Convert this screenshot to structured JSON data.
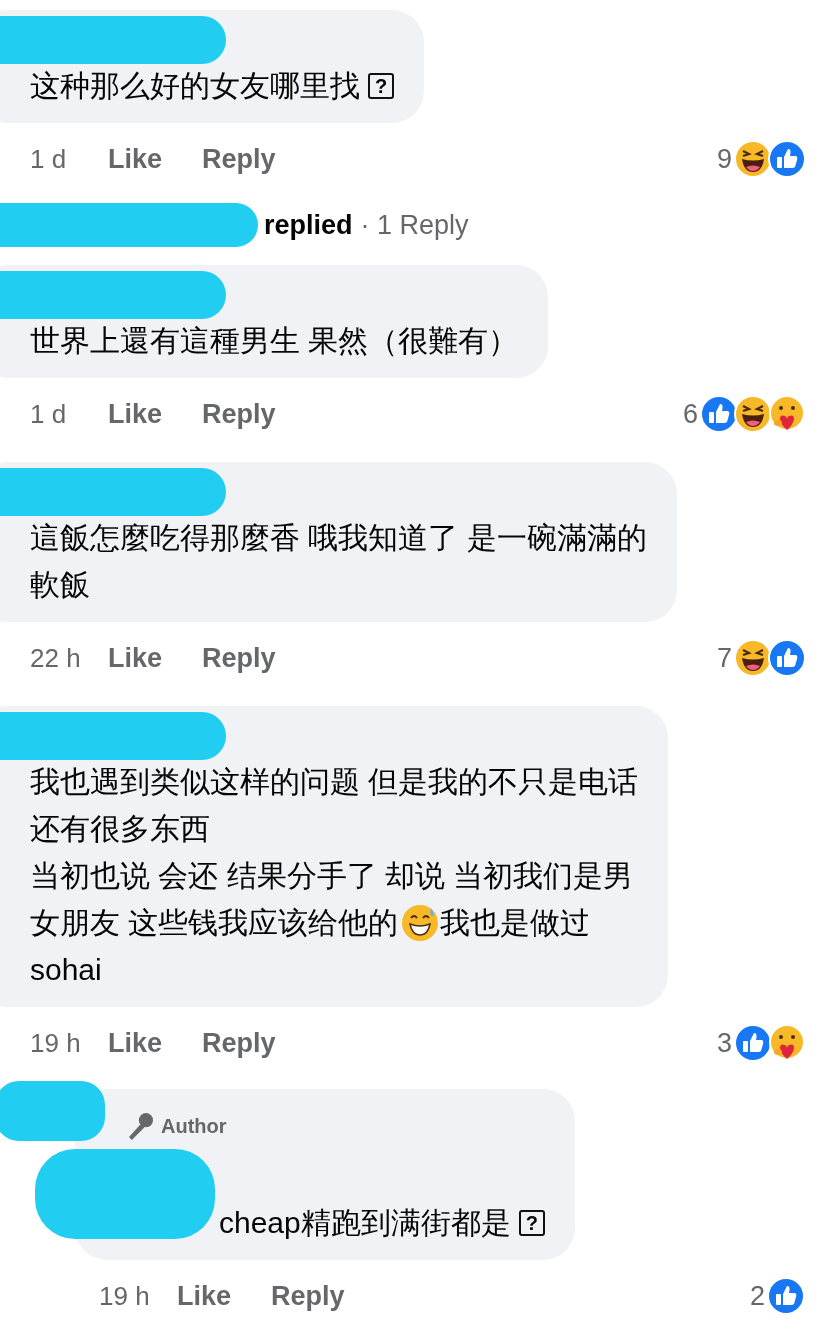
{
  "comments": [
    {
      "name_redacted": true,
      "lines": [
        [
          {
            "kind": "text",
            "text": "这种那么好的女友哪里找"
          },
          {
            "kind": "missing",
            "text": "?"
          }
        ]
      ],
      "time": "1 d",
      "like": "Like",
      "reply": "Reply",
      "count": "9",
      "reactions": [
        {
          "kind": "haha"
        },
        {
          "kind": "like"
        }
      ],
      "indented": false,
      "thread": {
        "label": "replied",
        "link": "· 1 Reply"
      }
    },
    {
      "name_redacted": true,
      "lines": [
        [
          {
            "kind": "text",
            "text": "世界上還有這種男生 果然（很難有）"
          }
        ]
      ],
      "time": "1 d",
      "like": "Like",
      "reply": "Reply",
      "count": "6",
      "reactions": [
        {
          "kind": "like"
        },
        {
          "kind": "haha"
        },
        {
          "kind": "care"
        }
      ],
      "indented": false
    },
    {
      "name_redacted": true,
      "lines": [
        [
          {
            "kind": "text",
            "text": "這飯怎麼吃得那麼香 哦我知道了 是一碗滿滿的"
          }
        ],
        [
          {
            "kind": "text",
            "text": "軟飯"
          }
        ]
      ],
      "time": "22 h",
      "like": "Like",
      "reply": "Reply",
      "count": "7",
      "reactions": [
        {
          "kind": "haha"
        },
        {
          "kind": "like"
        }
      ],
      "indented": false
    },
    {
      "name_redacted": true,
      "lines": [
        [
          {
            "kind": "text",
            "text": "我也遇到类似这样的问题 但是我的不只是电话"
          }
        ],
        [
          {
            "kind": "text",
            "text": "还有很多东西"
          }
        ],
        [
          {
            "kind": "text",
            "text": "当初也说 会还 结果分手了 却说 当初我们是男"
          }
        ],
        [
          {
            "kind": "text",
            "text": "女朋友 这些钱我应该给他的"
          },
          {
            "kind": "emoji"
          },
          {
            "kind": "text",
            "text": " 我也是做过"
          }
        ],
        [
          {
            "kind": "text",
            "text": "sohai"
          }
        ]
      ],
      "time": "19 h",
      "like": "Like",
      "reply": "Reply",
      "count": "3",
      "reactions": [
        {
          "kind": "like"
        },
        {
          "kind": "care"
        }
      ],
      "indented": false
    },
    {
      "name_redacted": true,
      "author_badge": "Author",
      "lines": [
        [
          {
            "kind": "text",
            "text": "cheap精跑到满街都是"
          },
          {
            "kind": "missing",
            "text": "?"
          }
        ]
      ],
      "time": "19 h",
      "like": "Like",
      "reply": "Reply",
      "count": "2",
      "reactions": [
        {
          "kind": "like"
        }
      ],
      "indented": true
    }
  ]
}
